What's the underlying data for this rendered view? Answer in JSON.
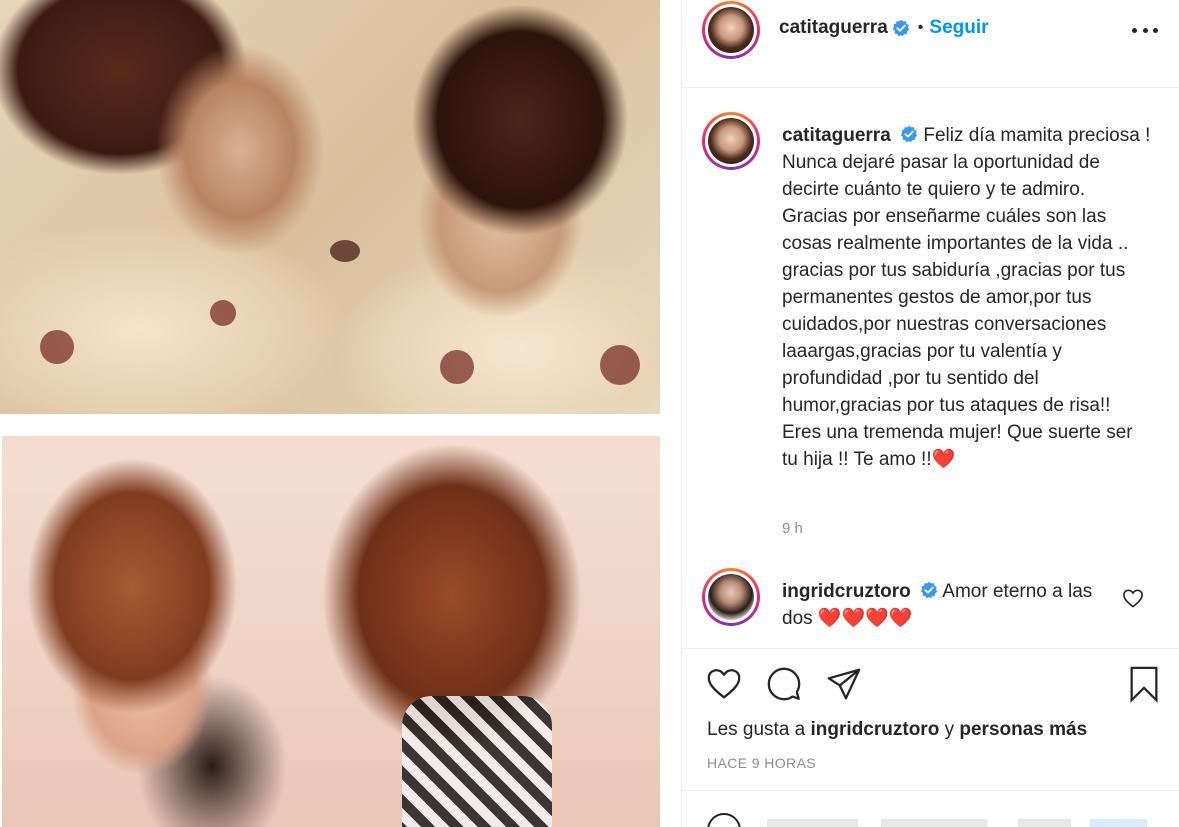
{
  "post": {
    "author": "catitaguerra",
    "separator": "•",
    "follow_label": "Seguir",
    "caption": "Feliz día mamita preciosa ! Nunca dejaré pasar la oportunidad de decirte cuánto te quiero y te admiro. Gracias por enseñarme cuáles son las cosas realmente importantes de la vida .. gracias por tus sabiduría ,gracias por tus permanentes gestos de amor,por tus cuidados,por nuestras conversaciones laaargas,gracias por tu valentía y profundidad ,por tu sentido del humor,gracias por tus ataques de risa!! Eres una tremenda mujer! Que suerte ser tu hija !! Te amo !!",
    "caption_emoji": "❤️",
    "caption_time": "9 h"
  },
  "comment": {
    "author": "ingridcruztoro",
    "text": "Amor eterno a las dos",
    "emoji": "❤️❤️❤️❤️"
  },
  "likes": {
    "prefix": "Les gusta a",
    "user": "ingridcruztoro",
    "conjunction": "y",
    "others": "personas más"
  },
  "posted_ago": "HACE 9 HORAS",
  "colors": {
    "accent": "#0095f6",
    "verified": "#3897f0",
    "heart": "#ed1c24"
  },
  "icons": [
    "verified-badge-icon",
    "more-options-icon",
    "heart-icon",
    "comment-icon",
    "share-icon",
    "bookmark-icon"
  ]
}
